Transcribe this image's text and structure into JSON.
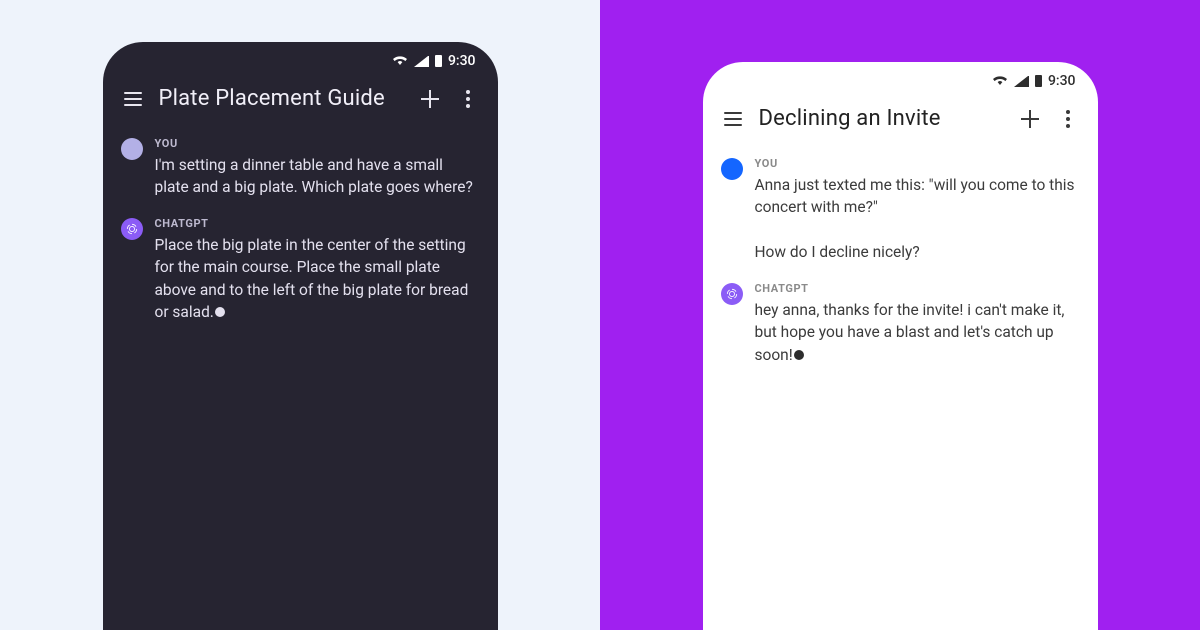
{
  "status": {
    "time": "9:30"
  },
  "labels": {
    "you": "YOU",
    "assistant": "CHATGPT"
  },
  "left": {
    "title": "Plate Placement Guide",
    "messages": {
      "user": "I'm setting a dinner table and have a small plate and a big plate. Which plate goes where?",
      "assistant": "Place the big plate in the center of the setting for the main course. Place the small plate above and to the left of the big plate for bread or salad."
    }
  },
  "right": {
    "title": "Declining an Invite",
    "messages": {
      "user": "Anna just texted me this: \"will you come to this concert with me?\"\n\nHow do I decline nicely?",
      "assistant": "hey anna, thanks for the invite! i can't make it, but hope you have a blast and let's catch up soon!"
    }
  },
  "colors": {
    "left_bg": "#eef3fb",
    "right_bg": "#a020f0",
    "phone_dark": "#262431",
    "phone_light": "#ffffff",
    "accent_purple": "#8b5cf6"
  }
}
